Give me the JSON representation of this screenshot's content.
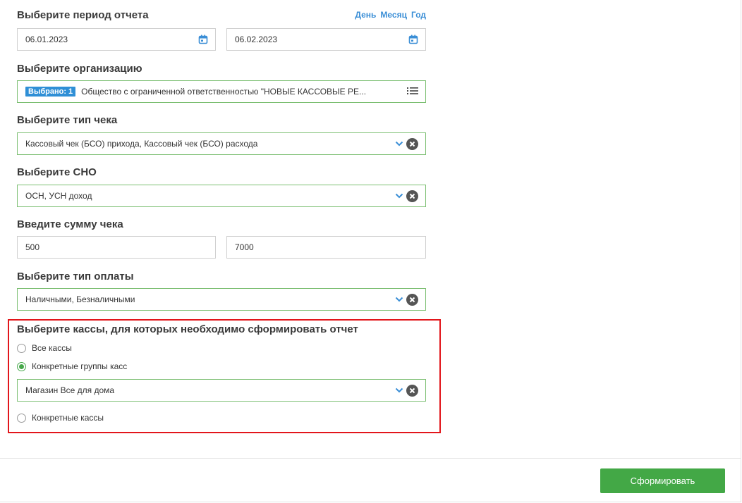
{
  "period": {
    "title": "Выберите период отчета",
    "links": [
      "День",
      "Месяц",
      "Год"
    ],
    "date_from": "06.01.2023",
    "date_to": "06.02.2023"
  },
  "organization": {
    "title": "Выберите организацию",
    "badge": "Выбрано: 1",
    "value": "Общество с ограниченной ответственностью \"НОВЫЕ КАССОВЫЕ РЕ..."
  },
  "receipt_type": {
    "title": "Выберите тип чека",
    "value": "Кассовый чек (БСО) прихода, Кассовый чек (БСО) расхода"
  },
  "tax_system": {
    "title": "Выберите СНО",
    "value": "ОСН, УСН доход"
  },
  "amount": {
    "title": "Введите сумму чека",
    "from": "500",
    "to": "7000"
  },
  "payment_type": {
    "title": "Выберите тип оплаты",
    "value": "Наличными, Безналичными"
  },
  "registers": {
    "title": "Выберите кассы, для которых необходимо сформировать отчет",
    "option_all": "Все кассы",
    "option_groups": "Конкретные группы касс",
    "group_value": "Магазин Все для дома",
    "option_specific": "Конкретные кассы",
    "selected": "groups"
  },
  "submit_label": "Сформировать",
  "colors": {
    "accent_green": "#43a846",
    "link_blue": "#3a8ed6",
    "highlight_red": "#e2161b"
  }
}
